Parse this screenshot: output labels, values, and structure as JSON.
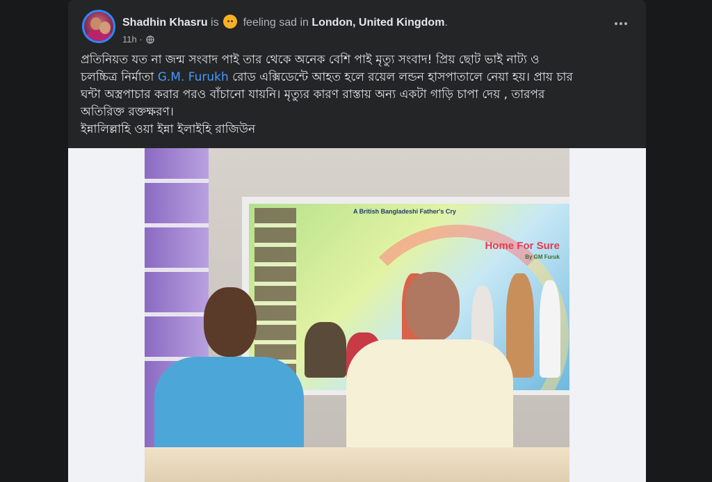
{
  "post": {
    "author": "Shadhin Khasru",
    "is_text": "is",
    "feeling": "feeling sad",
    "in_text": "in",
    "location": "London, United Kingdom",
    "period": ".",
    "time": "11h",
    "separator": "·",
    "audience_icon": "globe-icon",
    "more_icon": "more-horizontal-icon",
    "text": {
      "line1": "প্রতিনিয়ত যত না জন্ম সংবাদ পাই তার থেকে অনেক বেশি পাই মৃত্যু সংবাদ! প্রিয় ছোট ভাই নাট্য ও",
      "line2_start": "চলচ্চিত্র নির্মাতা ",
      "mention": "G.M. Furukh",
      "line2_end": " রোড এক্সিডেন্টে আহত হলে রয়েল লন্ডন হাসপাতালে নেয়া হয়। প্রায় চার",
      "line3": "ঘন্টা অস্ত্রপাচার করার পরও বাঁচানো যায়নি। মৃত্যুর কারণ রাস্তায় অন্য একটা গাড়ি চাপা দেয় , তারপর",
      "line4": "অতিরিক্ত রক্তক্ষরণ।",
      "line5": "ইন্নালিল্লাহি ওয়া ইন্না ইলাইহি রাজিউন"
    },
    "image": {
      "screen_banner": "A British Bangladeshi Father's Cry",
      "screen_title": "Home For Sure",
      "screen_credit": "By GM Furuk"
    }
  },
  "colors": {
    "background": "#18191a",
    "card": "#242526",
    "link": "#4599ff"
  }
}
